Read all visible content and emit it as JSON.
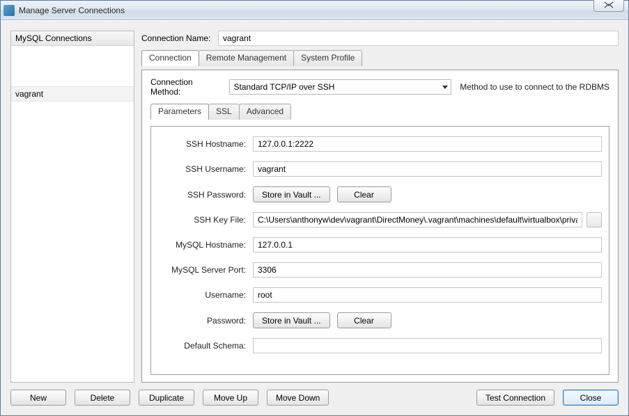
{
  "window": {
    "title": "Manage Server Connections"
  },
  "sidebar": {
    "header": "MySQL Connections",
    "items": [
      {
        "label": "vagrant"
      }
    ]
  },
  "connection_name": {
    "label": "Connection Name:",
    "value": "vagrant"
  },
  "tabs": {
    "connection": "Connection",
    "remote": "Remote Management",
    "profile": "System Profile"
  },
  "method": {
    "label": "Connection Method:",
    "value": "Standard TCP/IP over SSH",
    "hint": "Method to use to connect to the RDBMS"
  },
  "inner_tabs": {
    "parameters": "Parameters",
    "ssl": "SSL",
    "advanced": "Advanced"
  },
  "fields": {
    "ssh_hostname": {
      "label": "SSH Hostname:",
      "value": "127.0.0.1:2222"
    },
    "ssh_username": {
      "label": "SSH Username:",
      "value": "vagrant"
    },
    "ssh_password": {
      "label": "SSH Password:",
      "store": "Store in Vault ...",
      "clear": "Clear"
    },
    "ssh_keyfile": {
      "label": "SSH Key File:",
      "value": "C:\\Users\\anthonyw\\dev\\vagrant\\DirectMoney\\.vagrant\\machines\\default\\virtualbox\\private_key"
    },
    "mysql_hostname": {
      "label": "MySQL Hostname:",
      "value": "127.0.0.1"
    },
    "mysql_port": {
      "label": "MySQL Server Port:",
      "value": "3306"
    },
    "username": {
      "label": "Username:",
      "value": "root"
    },
    "password": {
      "label": "Password:",
      "store": "Store in Vault ...",
      "clear": "Clear"
    },
    "default_schema": {
      "label": "Default Schema:",
      "value": ""
    }
  },
  "buttons": {
    "new": "New",
    "delete": "Delete",
    "duplicate": "Duplicate",
    "move_up": "Move Up",
    "move_down": "Move Down",
    "test": "Test Connection",
    "close": "Close"
  }
}
